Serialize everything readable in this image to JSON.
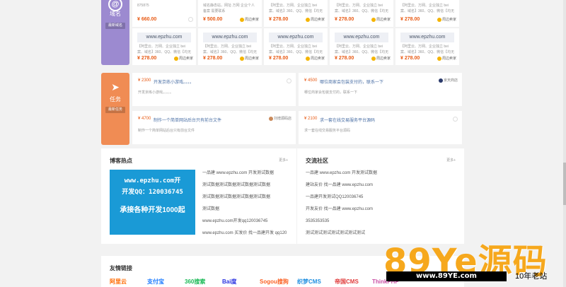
{
  "domain_section": {
    "title": "域名",
    "tag": "最新域名",
    "top_cards": [
      {
        "desc": "875875",
        "price": "¥ 660.00",
        "badge": ""
      },
      {
        "desc": "域名静态站，网址·万网 企业个人备案 需要联系",
        "price": "¥ 500.00",
        "badge": "周边卖家"
      },
      {
        "desc": "【阿里云、万网、企业独立 bei案、域名】360、QQ、微信【均无",
        "price": "¥ 278.00",
        "badge": "周边卖家"
      },
      {
        "desc": "【阿里云、万网、企业独立 bei案、域名】360、QQ、微信【均无",
        "price": "¥ 278.00",
        "badge": "周边卖家"
      },
      {
        "desc": "【阿里云、万网、企业独立 bei案、域名】360、QQ、微信【均无",
        "price": "¥ 278.00",
        "badge": "周边卖家"
      }
    ],
    "bottom_cards": [
      {
        "name": "www.epzhu.com",
        "desc": "【阿里云、万网、企业独立 bei案、域名】360、QQ、微信【均无",
        "price": "¥ 278.00",
        "badge": "周边卖家"
      },
      {
        "name": "www.epzhu.com",
        "desc": "【阿里云、万网、企业独立 bei案、域名】360、QQ、微信【均无",
        "price": "¥ 278.00",
        "badge": "周边卖家"
      },
      {
        "name": "www.epzhu.com",
        "desc": "【阿里云、万网、企业独立 bei案、域名】360、QQ、微信【均无",
        "price": "¥ 278.00",
        "badge": "周边卖家"
      },
      {
        "name": "www.epzhu.com",
        "desc": "【阿里云、万网、企业独立 bei案、域名】360、QQ、微信【均无",
        "price": "¥ 278.00",
        "badge": "周边卖家"
      },
      {
        "name": "www.epzhu.com",
        "desc": "【阿里云、万网、企业独立 bei案、域名】360、QQ、微信【均无",
        "price": "¥ 278.00",
        "badge": "周边卖家"
      }
    ]
  },
  "task_section": {
    "title": "任务",
    "tag": "最新任务",
    "tasks": [
      {
        "price": "¥ 2300",
        "title": "开发京练小游戏。。。。",
        "desc": "开发京练小游戏。。。。。",
        "user": ""
      },
      {
        "price": "¥ 4500",
        "title": "哪位商家会包装支付的，联系一下",
        "desc": "哪位商家会包装支付的，联系一下",
        "user": "京天商店"
      },
      {
        "price": "¥ 4700",
        "title": "制作一个简单网站后台只有前台文件",
        "desc": "制作一个简单网站后台只有前台文件",
        "user": "刘增源码店"
      },
      {
        "price": "¥ 2100",
        "title": "求一套在线交易服务平台源码",
        "desc": "求一套在线交易服务平台源码",
        "user": ""
      }
    ]
  },
  "blog": {
    "title": "博客热点",
    "more": "更多+",
    "banner": {
      "line1": "www.epzhu.com开",
      "line2": "开发QQ：120036745",
      "line3": "承接各种开发1000起"
    },
    "items": [
      "一品建 www.epzhu.com 开发测试数据",
      "测试数据测试数据测试数据测试数据",
      "测试数据测试数据测试数据测试数据",
      "测试数据",
      "www.epzhu.com开发qq120036745",
      "www.epzhu.com 买发价 找一品建开发 qq120"
    ]
  },
  "community": {
    "title": "交流社区",
    "more": "更多+",
    "items": [
      "一品建 www.epzhu.com 开发测试数据",
      "建站友价 找一品建 www.epzhu.com",
      "一品建开发测试QQ120036745",
      "开发友价 找一品建 www.epzhu.com",
      "3535353535",
      "测试测试测试测试测试测试测试"
    ]
  },
  "friend_links": {
    "title": "友情链接",
    "logos": [
      {
        "label": "阿里云",
        "color": "#ff6a00"
      },
      {
        "label": "支付宝",
        "color": "#1677ff"
      },
      {
        "label": "360搜索",
        "color": "#19b955"
      },
      {
        "label": "Bai度",
        "color": "#2932e1"
      },
      {
        "label": "Sogou搜狗",
        "color": "#fb6022"
      },
      {
        "label": "织梦CMS",
        "color": "#1f8fe0"
      },
      {
        "label": "帝国CMS",
        "color": "#e03c3c"
      },
      {
        "label": "ThinkPHP",
        "color": "#c94fa4"
      }
    ]
  },
  "watermark": {
    "big": "89Ye源码",
    "url": "www.89YE.com",
    "tag": "10年老站"
  }
}
